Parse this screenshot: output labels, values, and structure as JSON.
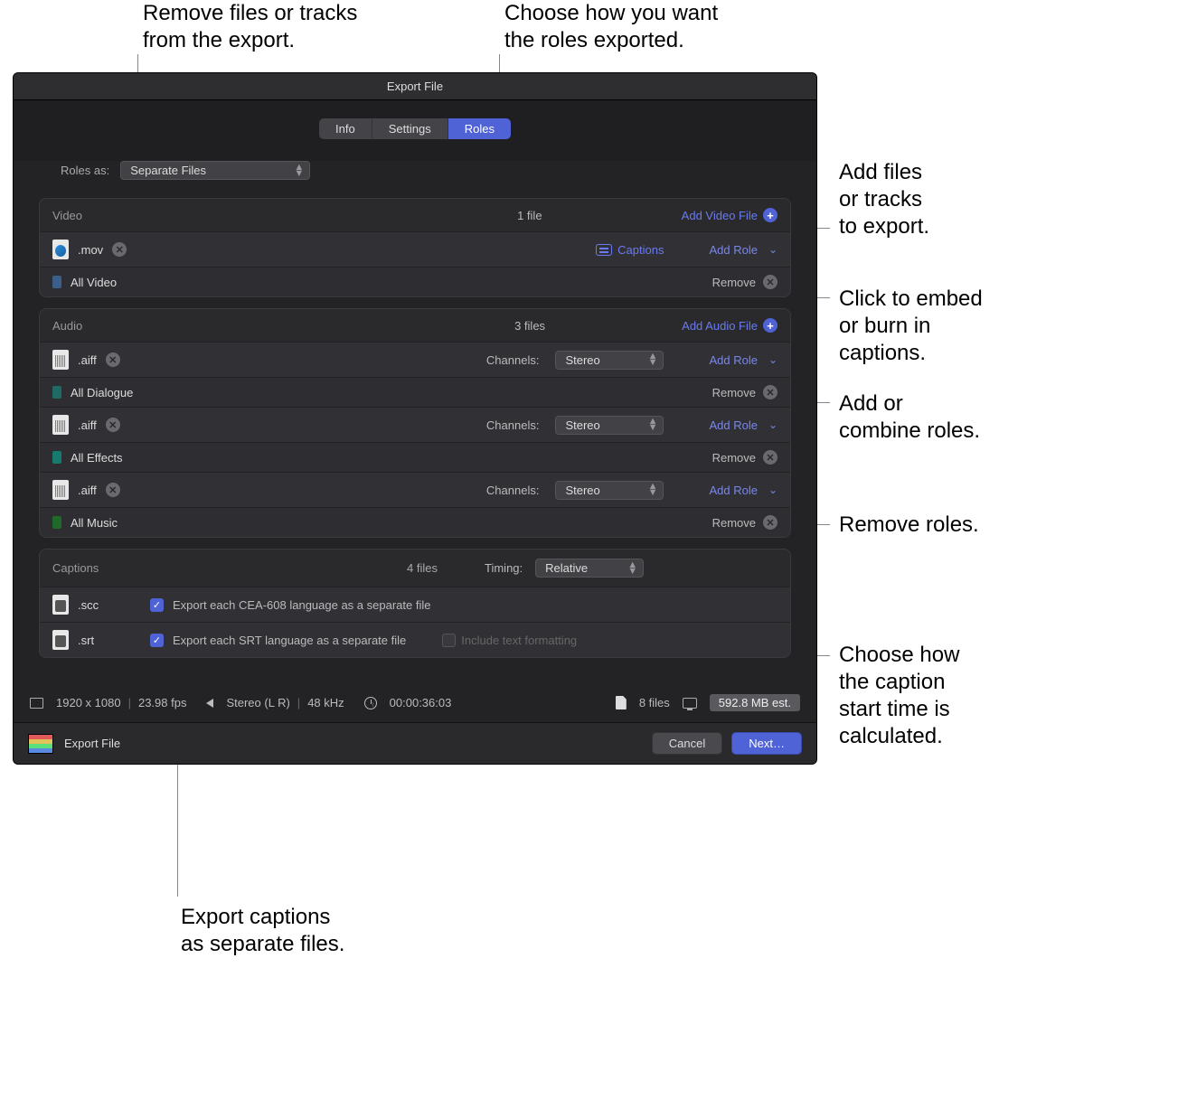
{
  "callouts": {
    "top_left": "Remove files or tracks\nfrom the export.",
    "top_right": "Choose how you want\nthe roles exported.",
    "r1": "Add files\nor tracks\nto export.",
    "r2": "Click to embed\nor burn in\ncaptions.",
    "r3": "Add or\ncombine roles.",
    "r4": "Remove roles.",
    "r5": "Choose how\nthe caption\nstart time is\ncalculated.",
    "bottom": "Export captions\nas separate files."
  },
  "dialog": {
    "title": "Export File",
    "tabs": {
      "info": "Info",
      "settings": "Settings",
      "roles": "Roles"
    },
    "roles_as_label": "Roles as:",
    "roles_as_value": "Separate Files",
    "video": {
      "title": "Video",
      "count": "1 file",
      "add": "Add Video File",
      "file_ext": ".mov",
      "captions_btn": "Captions",
      "add_role": "Add Role",
      "role_name": "All Video",
      "remove": "Remove"
    },
    "audio": {
      "title": "Audio",
      "count": "3 files",
      "add": "Add Audio File",
      "channels_label": "Channels:",
      "channels_value": "Stereo",
      "add_role": "Add Role",
      "remove": "Remove",
      "files": [
        {
          "ext": ".aiff",
          "role": "All Dialogue",
          "swatch": "sw-teal"
        },
        {
          "ext": ".aiff",
          "role": "All Effects",
          "swatch": "sw-teal2"
        },
        {
          "ext": ".aiff",
          "role": "All Music",
          "swatch": "sw-green"
        }
      ]
    },
    "captions": {
      "title": "Captions",
      "count": "4 files",
      "timing_label": "Timing:",
      "timing_value": "Relative",
      "scc_ext": ".scc",
      "scc_check_label": "Export each CEA-608 language as a separate file",
      "srt_ext": ".srt",
      "srt_check_label": "Export each SRT language as a separate file",
      "include_formatting": "Include text formatting"
    },
    "status": {
      "res": "1920 x 1080",
      "fps": "23.98 fps",
      "audio": "Stereo (L R)",
      "rate": "48 kHz",
      "duration": "00:00:36:03",
      "files": "8 files",
      "est": "592.8 MB est."
    },
    "footer": {
      "label": "Export File",
      "cancel": "Cancel",
      "next": "Next…"
    }
  }
}
